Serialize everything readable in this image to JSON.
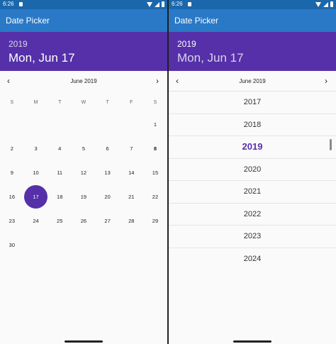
{
  "status_bar": {
    "time": "6:26"
  },
  "app": {
    "title": "Date Picker"
  },
  "left": {
    "header": {
      "year": "2019",
      "date": "Mon, Jun 17"
    },
    "month_title": "June 2019",
    "weekdays": [
      "S",
      "M",
      "T",
      "W",
      "T",
      "F",
      "S"
    ],
    "days": [
      "",
      "",
      "",
      "",
      "",
      "",
      "1",
      "2",
      "3",
      "4",
      "5",
      "6",
      "7",
      "8",
      "9",
      "10",
      "11",
      "12",
      "13",
      "14",
      "15",
      "16",
      "17",
      "18",
      "19",
      "20",
      "21",
      "22",
      "23",
      "24",
      "25",
      "26",
      "27",
      "28",
      "29",
      "30"
    ],
    "selected_day": "17"
  },
  "right": {
    "header": {
      "year": "2019",
      "date": "Mon, Jun 17"
    },
    "month_title": "June 2019",
    "years": [
      "2017",
      "2018",
      "2019",
      "2020",
      "2021",
      "2022",
      "2023",
      "2024"
    ],
    "selected_year": "2019"
  },
  "colors": {
    "primary_dark": "#1b67ab",
    "primary": "#2979c7",
    "accent": "#5530a8"
  }
}
